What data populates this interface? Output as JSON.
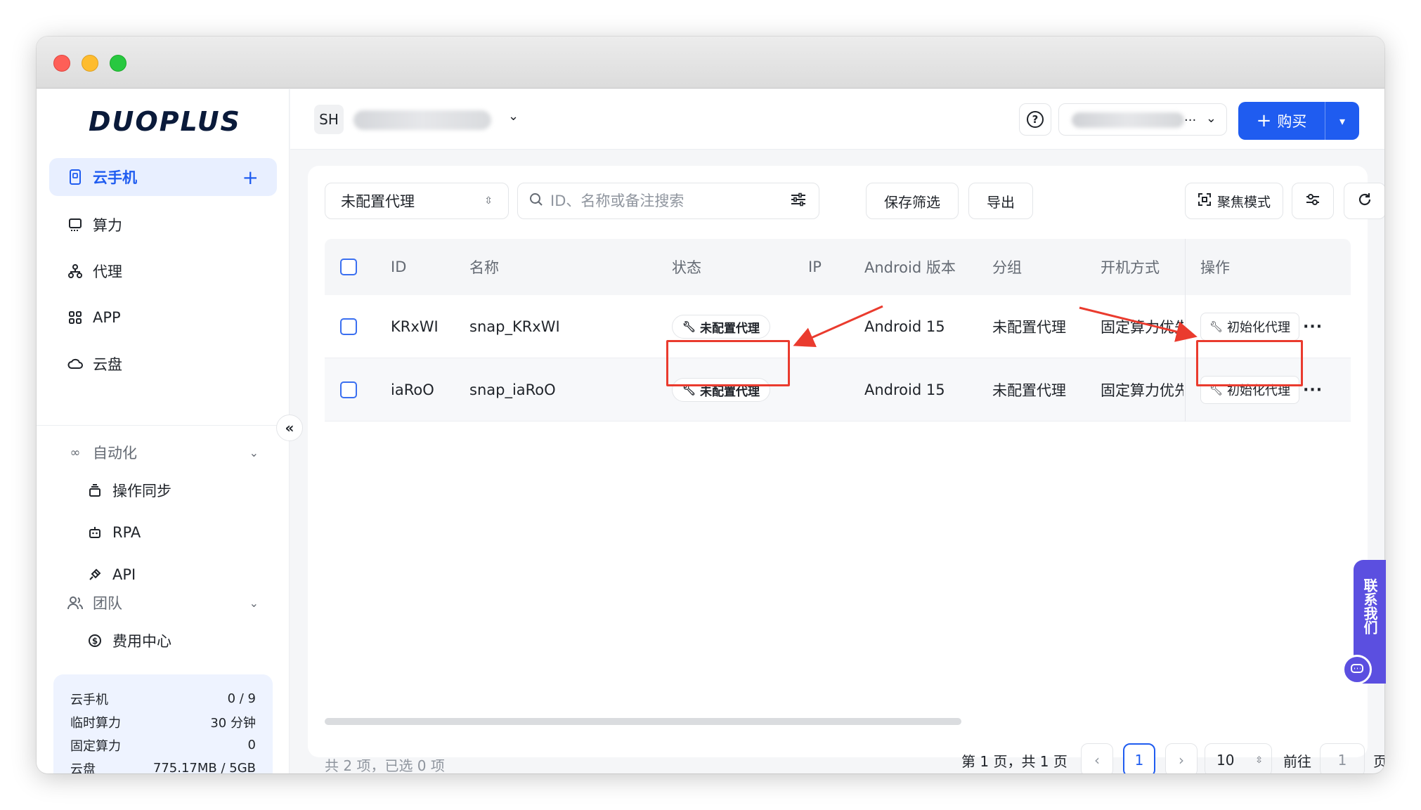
{
  "brand": {
    "logo": "DUOPLUS"
  },
  "sidebar": {
    "items": [
      {
        "label": "云手机",
        "icon": "phone-icon",
        "active": true
      },
      {
        "label": "算力",
        "icon": "monitor-icon"
      },
      {
        "label": "代理",
        "icon": "network-icon"
      },
      {
        "label": "APP",
        "icon": "apps-grid-icon"
      },
      {
        "label": "云盘",
        "icon": "cloud-icon"
      }
    ],
    "automation": {
      "label": "自动化",
      "children": [
        {
          "label": "操作同步",
          "icon": "sync-icon"
        },
        {
          "label": "RPA",
          "icon": "robot-icon"
        },
        {
          "label": "API",
          "icon": "plug-icon"
        }
      ]
    },
    "team": {
      "label": "团队",
      "children": [
        {
          "label": "费用中心",
          "icon": "dollar-icon"
        }
      ]
    },
    "quota": [
      {
        "label": "云手机",
        "value": "0 / 9"
      },
      {
        "label": "临时算力",
        "value": "30 分钟"
      },
      {
        "label": "固定算力",
        "value": "0"
      },
      {
        "label": "云盘",
        "value": "775.17MB / 5GB"
      }
    ]
  },
  "header": {
    "org_initials": "SH",
    "user_ellipsis": "...",
    "buy_label": "购买"
  },
  "toolbar": {
    "filter_value": "未配置代理",
    "search_placeholder": "ID、名称或备注搜索",
    "save_filter": "保存筛选",
    "export": "导出",
    "focus_mode": "聚焦模式"
  },
  "table": {
    "headers": [
      "ID",
      "名称",
      "状态",
      "IP",
      "Android 版本",
      "分组",
      "开机方式",
      "操作"
    ],
    "rows": [
      {
        "id": "KRxWI",
        "name": "snap_KRxWI",
        "status": "未配置代理",
        "ip": "",
        "android": "Android 15",
        "group": "未配置代理",
        "boot": "固定算力优先",
        "action": "初始化代理"
      },
      {
        "id": "iaRoO",
        "name": "snap_iaRoO",
        "status": "未配置代理",
        "ip": "",
        "android": "Android 15",
        "group": "未配置代理",
        "boot": "固定算力优先",
        "action": "初始化代理"
      }
    ]
  },
  "pagination": {
    "summary": "共 2 项，已选 0 项",
    "page_info": "第 1 页，共 1 页",
    "current_page": "1",
    "page_size": "10",
    "goto_label": "前往",
    "goto_value": "1",
    "page_suffix": "页"
  },
  "contact": {
    "label": "联系我们"
  },
  "annotations": {
    "highlight_color": "#ea3b2e"
  },
  "colors": {
    "accent": "#1f5cf0",
    "contact": "#5b4fe0"
  }
}
